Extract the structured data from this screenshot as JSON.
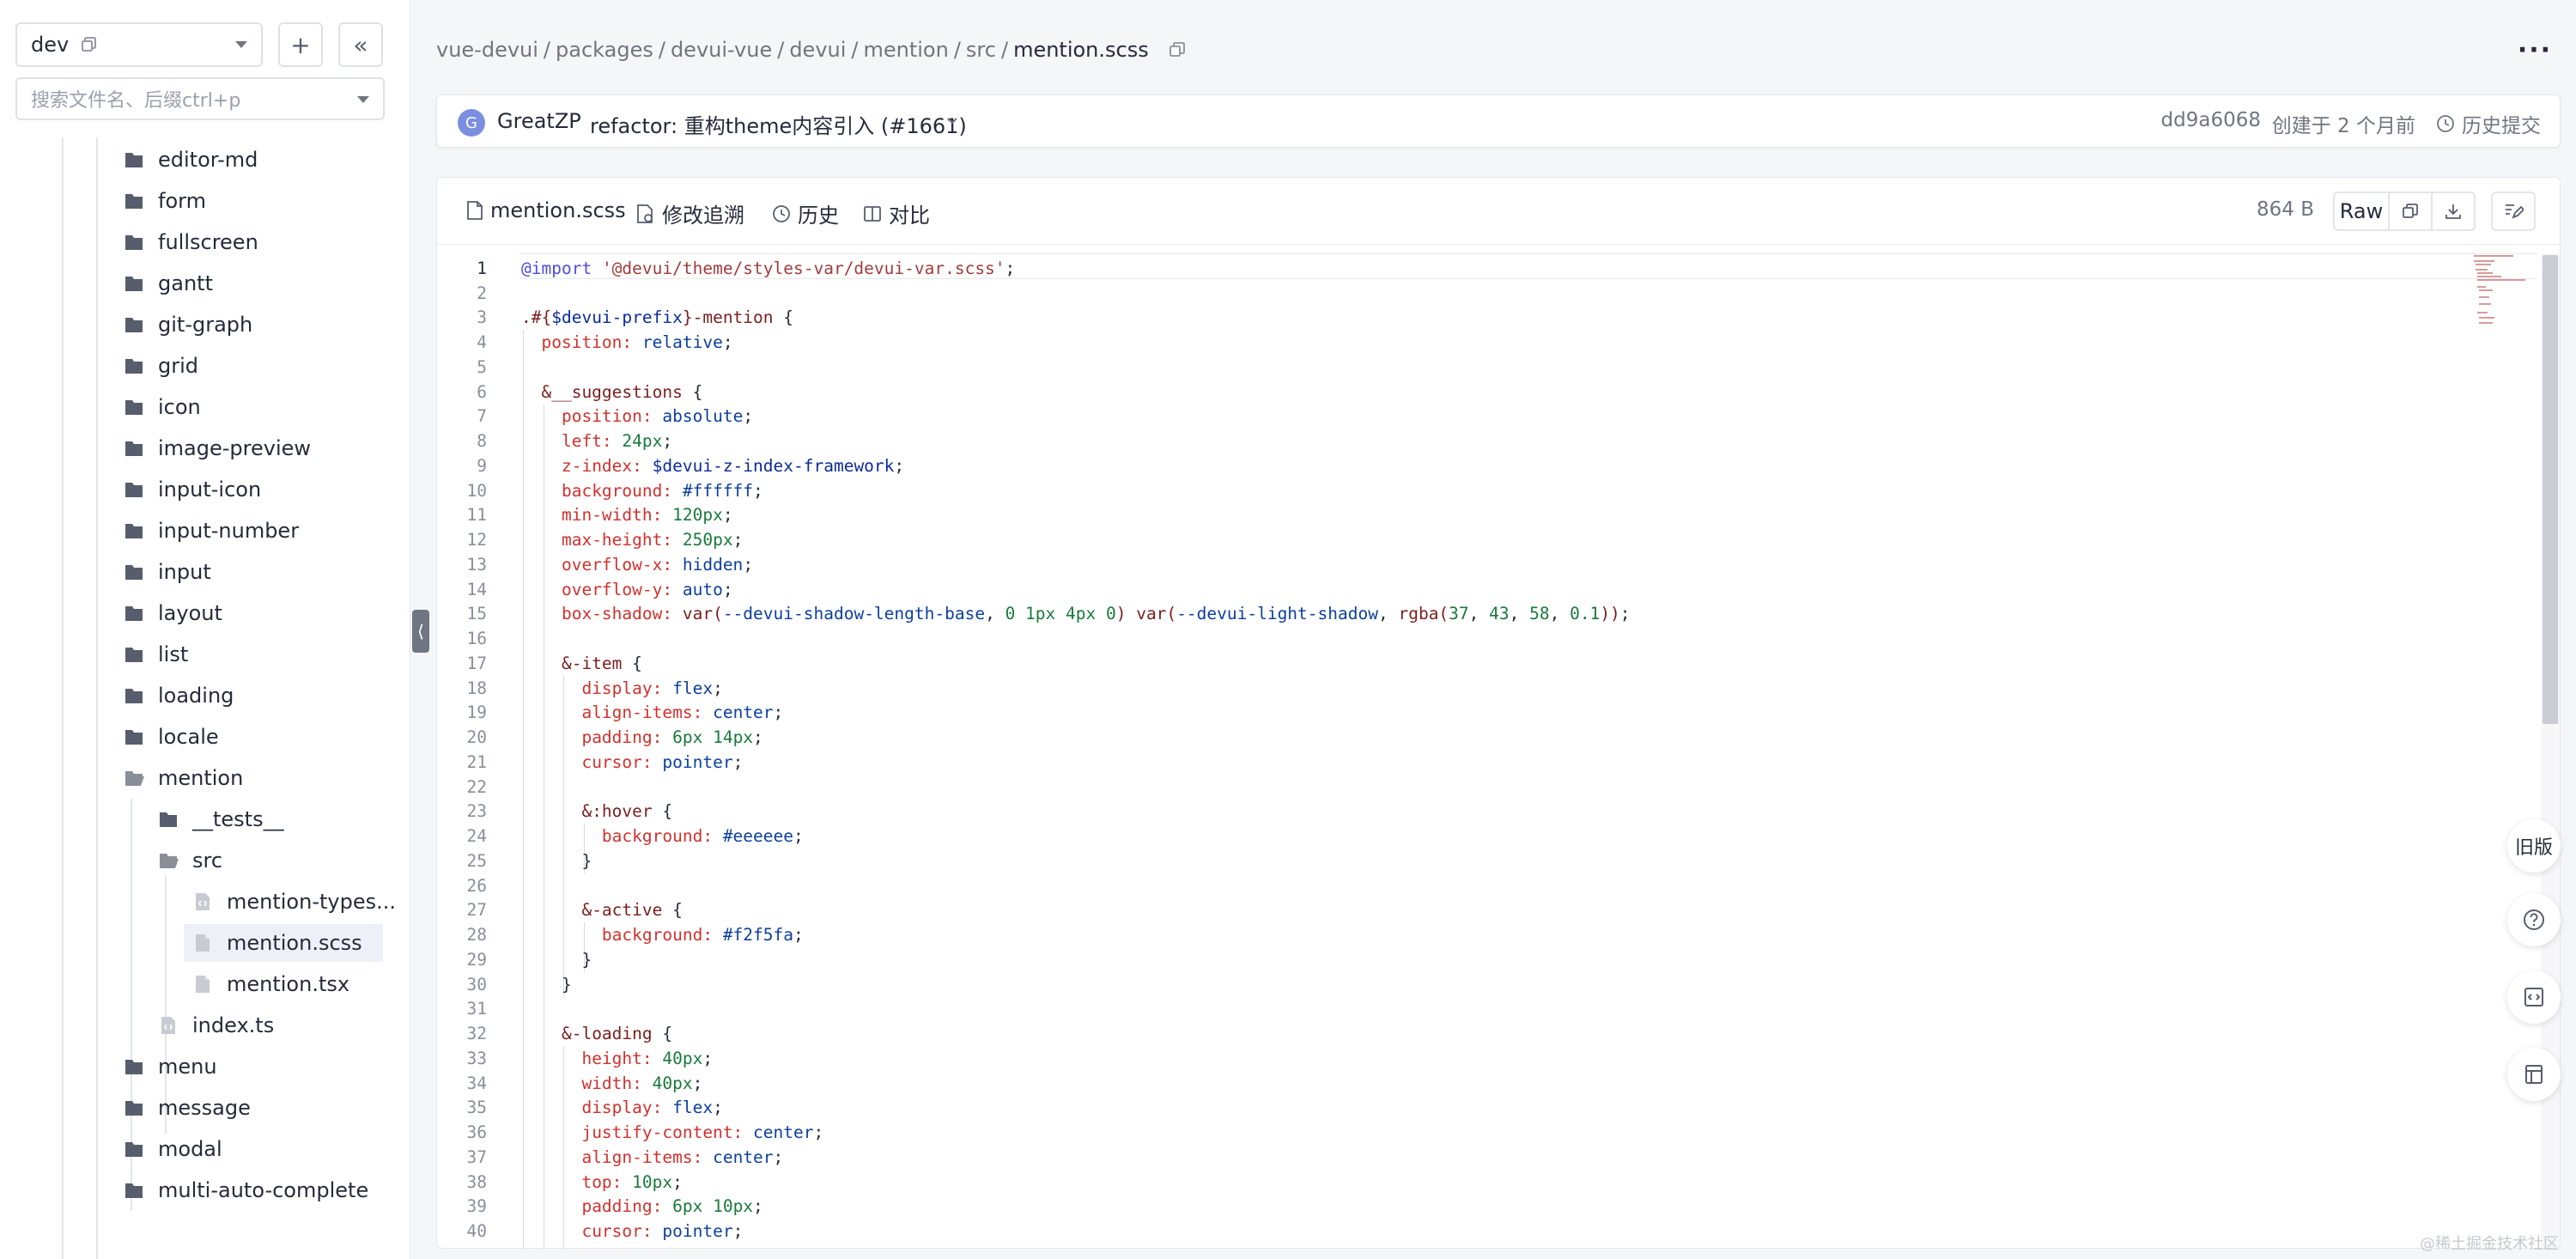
{
  "sidebar": {
    "branch": "dev",
    "search_placeholder": "搜索文件名、后缀ctrl+p",
    "tree": [
      {
        "name": "editor-md",
        "type": "folder",
        "depth": 1
      },
      {
        "name": "form",
        "type": "folder",
        "depth": 1
      },
      {
        "name": "fullscreen",
        "type": "folder",
        "depth": 1
      },
      {
        "name": "gantt",
        "type": "folder",
        "depth": 1
      },
      {
        "name": "git-graph",
        "type": "folder",
        "depth": 1
      },
      {
        "name": "grid",
        "type": "folder",
        "depth": 1
      },
      {
        "name": "icon",
        "type": "folder",
        "depth": 1
      },
      {
        "name": "image-preview",
        "type": "folder",
        "depth": 1
      },
      {
        "name": "input-icon",
        "type": "folder",
        "depth": 1
      },
      {
        "name": "input-number",
        "type": "folder",
        "depth": 1
      },
      {
        "name": "input",
        "type": "folder",
        "depth": 1
      },
      {
        "name": "layout",
        "type": "folder",
        "depth": 1
      },
      {
        "name": "list",
        "type": "folder",
        "depth": 1
      },
      {
        "name": "loading",
        "type": "folder",
        "depth": 1
      },
      {
        "name": "locale",
        "type": "folder",
        "depth": 1
      },
      {
        "name": "mention",
        "type": "folder-open",
        "depth": 1
      },
      {
        "name": "__tests__",
        "type": "folder",
        "depth": 2
      },
      {
        "name": "src",
        "type": "folder-open",
        "depth": 2
      },
      {
        "name": "mention-types...",
        "type": "code-file",
        "depth": 3
      },
      {
        "name": "mention.scss",
        "type": "file",
        "depth": 3,
        "selected": true
      },
      {
        "name": "mention.tsx",
        "type": "file",
        "depth": 3
      },
      {
        "name": "index.ts",
        "type": "code-file",
        "depth": 2
      },
      {
        "name": "menu",
        "type": "folder",
        "depth": 1
      },
      {
        "name": "message",
        "type": "folder",
        "depth": 1
      },
      {
        "name": "modal",
        "type": "folder",
        "depth": 1
      },
      {
        "name": "multi-auto-complete",
        "type": "folder",
        "depth": 1
      }
    ]
  },
  "breadcrumb": [
    "vue-devui",
    "packages",
    "devui-vue",
    "devui",
    "mention",
    "src",
    "mention.scss"
  ],
  "commit": {
    "avatar_letter": "G",
    "author": "GreatZP",
    "message": "refactor: 重构theme内容引入 (#1661)",
    "hash": "dd9a6068",
    "created": "创建于 2 个月前",
    "history": "历史提交"
  },
  "file_toolbar": {
    "filename": "mention.scss",
    "blame": "修改追溯",
    "history": "历史",
    "compare": "对比",
    "size": "864 B",
    "raw": "Raw"
  },
  "code": {
    "active_line": 1,
    "lines": [
      [
        [
          "kw",
          "@import"
        ],
        [
          "",
          " "
        ],
        [
          "str",
          "'@devui/theme/styles-var/devui-var.scss'"
        ],
        [
          "",
          ";"
        ]
      ],
      [],
      [
        [
          "sel",
          ".#{"
        ],
        [
          "var",
          "$devui-prefix"
        ],
        [
          "sel",
          "}-mention"
        ],
        [
          "",
          " {"
        ]
      ],
      [
        [
          "",
          "  "
        ],
        [
          "prop",
          "position:"
        ],
        [
          "",
          " "
        ],
        [
          "val",
          "relative"
        ],
        [
          "",
          ";"
        ]
      ],
      [],
      [
        [
          "",
          "  "
        ],
        [
          "sel",
          "&__suggestions"
        ],
        [
          "",
          " {"
        ]
      ],
      [
        [
          "",
          "    "
        ],
        [
          "prop",
          "position:"
        ],
        [
          "",
          " "
        ],
        [
          "val",
          "absolute"
        ],
        [
          "",
          ";"
        ]
      ],
      [
        [
          "",
          "    "
        ],
        [
          "prop",
          "left:"
        ],
        [
          "",
          " "
        ],
        [
          "num",
          "24px"
        ],
        [
          "",
          ";"
        ]
      ],
      [
        [
          "",
          "    "
        ],
        [
          "prop",
          "z-index:"
        ],
        [
          "",
          " "
        ],
        [
          "var",
          "$devui-z-index-framework"
        ],
        [
          "",
          ";"
        ]
      ],
      [
        [
          "",
          "    "
        ],
        [
          "prop",
          "background:"
        ],
        [
          "",
          " "
        ],
        [
          "val",
          "#ffffff"
        ],
        [
          "",
          ";"
        ]
      ],
      [
        [
          "",
          "    "
        ],
        [
          "prop",
          "min-width:"
        ],
        [
          "",
          " "
        ],
        [
          "num",
          "120px"
        ],
        [
          "",
          ";"
        ]
      ],
      [
        [
          "",
          "    "
        ],
        [
          "prop",
          "max-height:"
        ],
        [
          "",
          " "
        ],
        [
          "num",
          "250px"
        ],
        [
          "",
          ";"
        ]
      ],
      [
        [
          "",
          "    "
        ],
        [
          "prop",
          "overflow-x:"
        ],
        [
          "",
          " "
        ],
        [
          "val",
          "hidden"
        ],
        [
          "",
          ";"
        ]
      ],
      [
        [
          "",
          "    "
        ],
        [
          "prop",
          "overflow-y:"
        ],
        [
          "",
          " "
        ],
        [
          "val",
          "auto"
        ],
        [
          "",
          ";"
        ]
      ],
      [
        [
          "",
          "    "
        ],
        [
          "prop",
          "box-shadow:"
        ],
        [
          "",
          " "
        ],
        [
          "fn",
          "var("
        ],
        [
          "val",
          "--devui-shadow-length-base"
        ],
        [
          "",
          ", "
        ],
        [
          "num",
          "0 1px 4px 0"
        ],
        [
          "fn",
          ")"
        ],
        [
          "",
          " "
        ],
        [
          "fn",
          "var("
        ],
        [
          "val",
          "--devui-light-shadow"
        ],
        [
          "",
          ", "
        ],
        [
          "fn",
          "rgba("
        ],
        [
          "num",
          "37"
        ],
        [
          "",
          ", "
        ],
        [
          "num",
          "43"
        ],
        [
          "",
          ", "
        ],
        [
          "num",
          "58"
        ],
        [
          "",
          ", "
        ],
        [
          "num",
          "0.1"
        ],
        [
          "fn",
          "))"
        ],
        [
          "",
          ";"
        ]
      ],
      [],
      [
        [
          "",
          "    "
        ],
        [
          "sel",
          "&-item"
        ],
        [
          "",
          " {"
        ]
      ],
      [
        [
          "",
          "      "
        ],
        [
          "prop",
          "display:"
        ],
        [
          "",
          " "
        ],
        [
          "val",
          "flex"
        ],
        [
          "",
          ";"
        ]
      ],
      [
        [
          "",
          "      "
        ],
        [
          "prop",
          "align-items:"
        ],
        [
          "",
          " "
        ],
        [
          "val",
          "center"
        ],
        [
          "",
          ";"
        ]
      ],
      [
        [
          "",
          "      "
        ],
        [
          "prop",
          "padding:"
        ],
        [
          "",
          " "
        ],
        [
          "num",
          "6px 14px"
        ],
        [
          "",
          ";"
        ]
      ],
      [
        [
          "",
          "      "
        ],
        [
          "prop",
          "cursor:"
        ],
        [
          "",
          " "
        ],
        [
          "val",
          "pointer"
        ],
        [
          "",
          ";"
        ]
      ],
      [],
      [
        [
          "",
          "      "
        ],
        [
          "sel",
          "&:hover"
        ],
        [
          "",
          " {"
        ]
      ],
      [
        [
          "",
          "        "
        ],
        [
          "prop",
          "background:"
        ],
        [
          "",
          " "
        ],
        [
          "val",
          "#eeeeee"
        ],
        [
          "",
          ";"
        ]
      ],
      [
        [
          "",
          "      }"
        ]
      ],
      [],
      [
        [
          "",
          "      "
        ],
        [
          "sel",
          "&-active"
        ],
        [
          "",
          " {"
        ]
      ],
      [
        [
          "",
          "        "
        ],
        [
          "prop",
          "background:"
        ],
        [
          "",
          " "
        ],
        [
          "val",
          "#f2f5fa"
        ],
        [
          "",
          ";"
        ]
      ],
      [
        [
          "",
          "      }"
        ]
      ],
      [
        [
          "",
          "    }"
        ]
      ],
      [],
      [
        [
          "",
          "    "
        ],
        [
          "sel",
          "&-loading"
        ],
        [
          "",
          " {"
        ]
      ],
      [
        [
          "",
          "      "
        ],
        [
          "prop",
          "height:"
        ],
        [
          "",
          " "
        ],
        [
          "num",
          "40px"
        ],
        [
          "",
          ";"
        ]
      ],
      [
        [
          "",
          "      "
        ],
        [
          "prop",
          "width:"
        ],
        [
          "",
          " "
        ],
        [
          "num",
          "40px"
        ],
        [
          "",
          ";"
        ]
      ],
      [
        [
          "",
          "      "
        ],
        [
          "prop",
          "display:"
        ],
        [
          "",
          " "
        ],
        [
          "val",
          "flex"
        ],
        [
          "",
          ";"
        ]
      ],
      [
        [
          "",
          "      "
        ],
        [
          "prop",
          "justify-content:"
        ],
        [
          "",
          " "
        ],
        [
          "val",
          "center"
        ],
        [
          "",
          ";"
        ]
      ],
      [
        [
          "",
          "      "
        ],
        [
          "prop",
          "align-items:"
        ],
        [
          "",
          " "
        ],
        [
          "val",
          "center"
        ],
        [
          "",
          ";"
        ]
      ],
      [
        [
          "",
          "      "
        ],
        [
          "prop",
          "top:"
        ],
        [
          "",
          " "
        ],
        [
          "num",
          "10px"
        ],
        [
          "",
          ";"
        ]
      ],
      [
        [
          "",
          "      "
        ],
        [
          "prop",
          "padding:"
        ],
        [
          "",
          " "
        ],
        [
          "num",
          "6px 10px"
        ],
        [
          "",
          ";"
        ]
      ],
      [
        [
          "",
          "      "
        ],
        [
          "prop",
          "cursor:"
        ],
        [
          "",
          " "
        ],
        [
          "val",
          "pointer"
        ],
        [
          "",
          ";"
        ]
      ]
    ]
  },
  "float_buttons": {
    "old_version": "旧版"
  },
  "watermark": "@稀土掘金技术社区",
  "colors": {
    "accent_avatar": "#7b8ee0",
    "selected_bg": "#eef0f8",
    "property": "#d0312d",
    "value": "#0b3f9f",
    "number": "#197a3c",
    "string": "#a23b3b",
    "keyword": "#4e4ce0"
  }
}
